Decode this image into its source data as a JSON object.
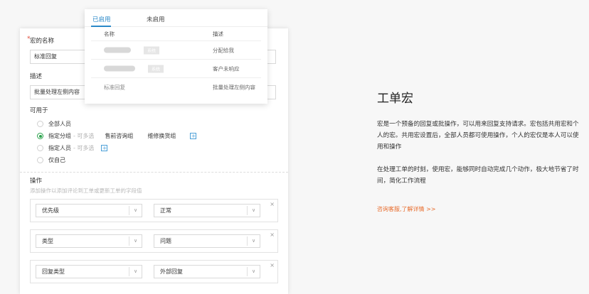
{
  "form": {
    "name_label": "宏的名称",
    "required_mark": "*",
    "name_value": "标准回复",
    "desc_label": "描述",
    "desc_value": "批量处理左侧内容",
    "available_label": "可用于",
    "options": [
      {
        "label": "全部人员",
        "hint": "",
        "selected": false
      },
      {
        "label": "指定分组",
        "hint": "- 可多选",
        "selected": true
      },
      {
        "label": "指定人员",
        "hint": "- 可多选",
        "selected": false
      },
      {
        "label": "仅自己",
        "hint": "",
        "selected": false
      }
    ],
    "groups": [
      "售前咨询组",
      "维修换货组"
    ],
    "plus_icon": "+",
    "ops_label": "操作",
    "ops_hint": "添加操作以添加评论到工单或更新工单的字段值",
    "ops": [
      {
        "field": "优先级",
        "value": "正常"
      },
      {
        "field": "类型",
        "value": "问题"
      },
      {
        "field": "回复类型",
        "value": "外部回复"
      }
    ],
    "close_icon": "×",
    "caret_icon": "∨"
  },
  "popup": {
    "tabs": [
      "已启用",
      "未启用"
    ],
    "headers": {
      "name": "名称",
      "desc": "描述"
    },
    "rows": [
      {
        "name": "",
        "tag": "系统",
        "desc": "分配给我"
      },
      {
        "name": "",
        "tag": "系统",
        "desc": "客户未响应"
      },
      {
        "name": "标准回复",
        "tag": "",
        "desc": "批量处理左侧内容"
      }
    ]
  },
  "info": {
    "title": "工单宏",
    "para1": "宏是一个预备的回复或批操作，可以用来回复支持请求。宏包括共用宏和个人的宏。共用宏设置后，全部人员都可使用操作，个人的宏仅是本人可以使用和操作",
    "para2": "在处理工单的时刻，使用宏，能够同时自动完成几个动作，极大地节省了时间，简化工作流程",
    "link": "咨询客服,了解详情 >>",
    "link_color": "#e86d2e"
  }
}
